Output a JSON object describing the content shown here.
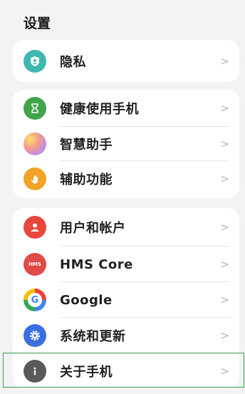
{
  "page_title": "设置",
  "chevron": ">",
  "groups": [
    {
      "items": [
        {
          "label": "隐私",
          "icon": "shield-icon",
          "color": "#3fb8b0"
        }
      ]
    },
    {
      "items": [
        {
          "label": "健康使用手机",
          "icon": "hourglass-icon",
          "color": "#3fa44a"
        },
        {
          "label": "智慧助手",
          "icon": "sphere-icon",
          "color": "#d88ad8"
        },
        {
          "label": "辅助功能",
          "icon": "hand-icon",
          "color": "#f1a427"
        }
      ]
    },
    {
      "items": [
        {
          "label": "用户和帐户",
          "icon": "user-icon",
          "color": "#e8473c"
        },
        {
          "label": "HMS Core",
          "icon": "hms-icon",
          "icon_text": "HMS",
          "color": "#e04a47"
        },
        {
          "label": "Google",
          "icon": "google-icon",
          "icon_text": "G",
          "color": "#4285f4"
        },
        {
          "label": "系统和更新",
          "icon": "gear-icon",
          "color": "#3a6fe0"
        },
        {
          "label": "关于手机",
          "icon": "info-icon",
          "color": "#5a5a5a"
        }
      ]
    }
  ]
}
